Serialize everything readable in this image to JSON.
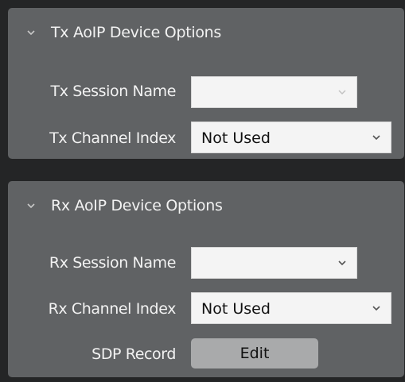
{
  "tx_options": {
    "title": "Tx AoIP Device Options",
    "session_name": {
      "label": "Tx Session Name",
      "value": ""
    },
    "channel_index": {
      "label": "Tx Channel Index",
      "value": "Not Used"
    }
  },
  "rx_options": {
    "title": "Rx AoIP Device Options",
    "session_name": {
      "label": "Rx Session Name",
      "value": ""
    },
    "channel_index": {
      "label": "Rx Channel Index",
      "value": "Not Used"
    },
    "sdp_record": {
      "label": "SDP Record",
      "button_label": "Edit"
    }
  },
  "colors": {
    "background": "#242526",
    "panel": "#606264",
    "text": "#f2f2f2",
    "dropdown_bg": "#f4f4f4",
    "button_bg": "#a9aaab"
  }
}
